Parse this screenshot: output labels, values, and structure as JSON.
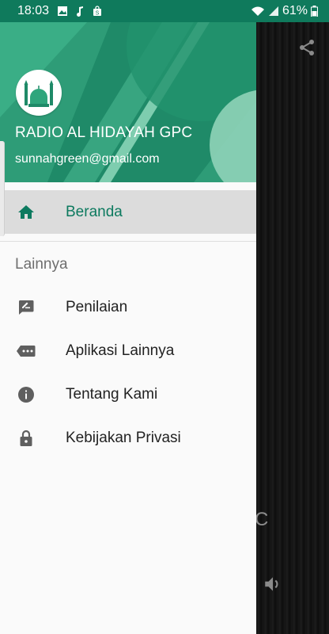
{
  "status_bar": {
    "time": "18:03",
    "battery": "61%",
    "left_icons": [
      "image-icon",
      "music-note-icon",
      "shopping-bag-icon"
    ],
    "right_icons": [
      "wifi-icon",
      "signal-icon",
      "battery-icon"
    ]
  },
  "drawer": {
    "header": {
      "app_name": "RADIO AL HIDAYAH GPC",
      "email": "sunnahgreen@gmail.com",
      "logo_icon": "mosque-icon",
      "colors": {
        "primary": "#2f9f7a",
        "dark": "#0f7a5c",
        "light": "#7fcfae"
      }
    },
    "main_items": [
      {
        "label": "Beranda",
        "icon": "home-icon",
        "active": true
      }
    ],
    "section_title": "Lainnya",
    "other_items": [
      {
        "label": "Penilaian",
        "icon": "rate-review-icon"
      },
      {
        "label": "Aplikasi Lainnya",
        "icon": "more-tag-icon"
      },
      {
        "label": "Tentang Kami",
        "icon": "info-icon"
      },
      {
        "label": "Kebijakan Privasi",
        "icon": "lock-icon"
      }
    ],
    "accent_color": "#0d7a5f"
  },
  "background_app": {
    "partial_text": "C",
    "share_icon": "share-icon",
    "volume_icon": "volume-icon"
  }
}
